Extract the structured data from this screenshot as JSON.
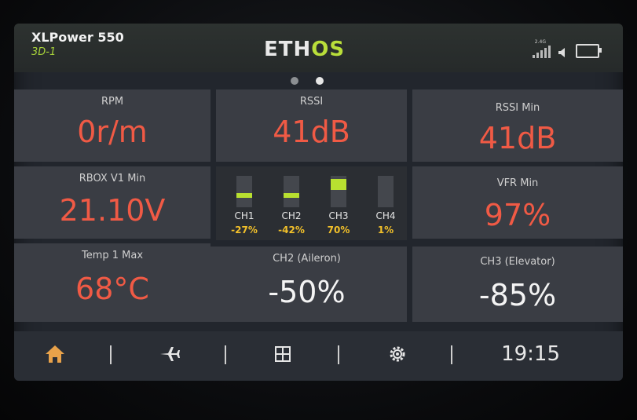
{
  "header": {
    "model_name": "XLPower 550",
    "model_sub": "3D-1",
    "logo_left": "ETH",
    "logo_right": "OS",
    "signal_label": "2.4G"
  },
  "page_dots": [
    false,
    true
  ],
  "widgets": {
    "rpm": {
      "title": "RPM",
      "value": "0r/m"
    },
    "rssi": {
      "title": "RSSI",
      "value": "41dB"
    },
    "rssi_min": {
      "title": "RSSI Min",
      "value": "41dB"
    },
    "rbox": {
      "title": "RBOX V1 Min",
      "value": "21.10V"
    },
    "vfr": {
      "title": "VFR Min",
      "value": "97%"
    },
    "temp": {
      "title": "Temp 1 Max",
      "value": "68°C"
    },
    "ch2_aileron": {
      "title": "CH2 (Aileron)",
      "value": "-50%"
    },
    "ch3_elevator": {
      "title": "CH3 (Elevator)",
      "value": "-85%"
    }
  },
  "channels": [
    {
      "name": "CH1",
      "value": "-27%",
      "level": -27
    },
    {
      "name": "CH2",
      "value": "-42%",
      "level": -42
    },
    {
      "name": "CH3",
      "value": "70%",
      "level": 70
    },
    {
      "name": "CH4",
      "value": "1%",
      "level": 1
    }
  ],
  "nav": {
    "icons": [
      "home-icon",
      "airplane-icon",
      "layout-icon",
      "gear-icon"
    ],
    "time": "19:15"
  },
  "colors": {
    "accent_green": "#b9de3a",
    "value_red": "#f05a45",
    "percent_yellow": "#f2c02a",
    "home_orange": "#e8a24a"
  }
}
